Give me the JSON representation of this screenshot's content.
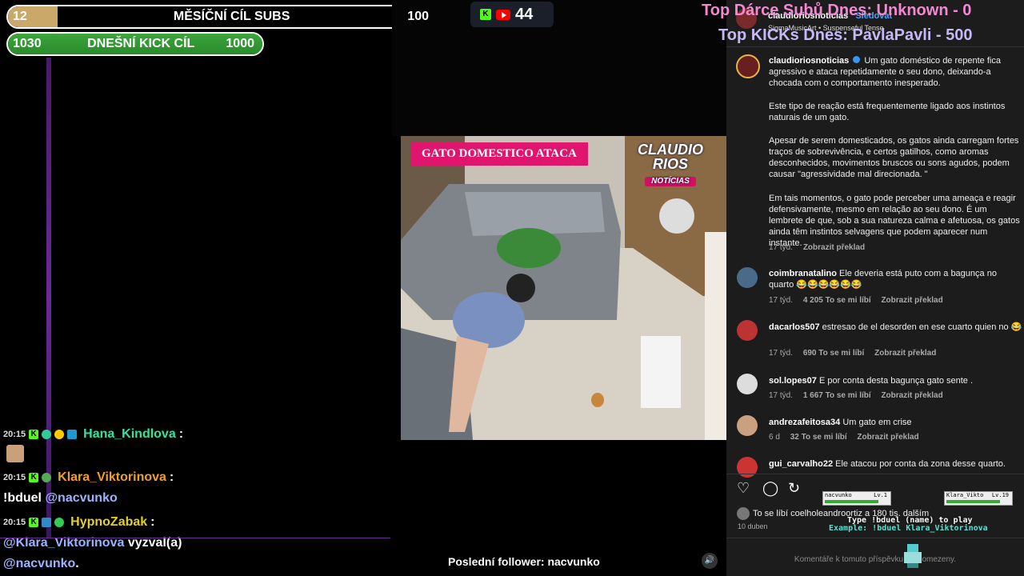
{
  "goals": {
    "monthly": {
      "current": "12",
      "label": "MĚSÍČNÍ CÍL SUBS",
      "target": "100",
      "progress": 0.12
    },
    "daily": {
      "current": "1030",
      "label": "DNEŠNÍ KICK CÍL",
      "target": "1000",
      "progress": 1.0
    }
  },
  "stream": {
    "viewers": "44",
    "video_title": "GATO DOMESTICO ATACA",
    "logo_line1": "CLAUDIO",
    "logo_line2": "RIOS",
    "logo_line3": "NOTÍCIAS",
    "last_follower": "Poslední follower: nacvunko"
  },
  "top": {
    "donor": "Top Dárce Subů Dnes: Unknown - 0",
    "kicks": "Top KICKs Dnes: PavlaPavli - 500"
  },
  "chat": [
    {
      "time": "20:15",
      "user": "Hana_Kindlova",
      "color": "#2ee6a0",
      "sep": ":"
    },
    {
      "time": "20:15",
      "user": "Klara_Viktorinova",
      "color": "#f0a020",
      "sep": ":",
      "msg_cmd": "!bduel",
      "msg_mention": "@nacvunko"
    },
    {
      "time": "20:15",
      "user": "HypnoZabak",
      "color": "#e6d020",
      "sep": ":",
      "msg_mention": "@Klara_Viktorinova",
      "msg_rest": "vyzval(a)",
      "msg_mention2": "@nacvunko",
      "msg_end": "."
    }
  ],
  "ig": {
    "header_user": "claudioriosnoticias",
    "header_follow": "Sledovat",
    "header_audio": "SigmaMusicArt • Suspenseful Tense",
    "caption_user": "claudioriosnoticias",
    "caption_p1": "Um gato doméstico de repente fica agressivo e ataca repetidamente o seu dono, deixando-a chocada com o comportamento inesperado.",
    "caption_p2": "Este tipo de reação está frequentemente ligado aos instintos naturais de um gato.",
    "caption_p3": "Apesar de serem domesticados, os gatos ainda carregam fortes traços de sobrevivência, e certos gatilhos, como aromas desconhecidos, movimentos bruscos ou sons agudos, podem causar \"agressividade mal direcionada. \"",
    "caption_p4": "Em tais momentos, o gato pode perceber uma ameaça e reagir defensivamente, mesmo em relação ao seu dono. É um lembrete de que, sob a sua natureza calma e afetuosa, os gatos ainda têm instintos selvagens que podem aparecer num instante.",
    "caption_time": "17 týd.",
    "translate": "Zobrazit překlad",
    "comments": [
      {
        "user": "coimbranatalino",
        "text": "Ele deveria está puto com a bagunça no quarto 😂😂😂😂😂😂",
        "time": "17 týd.",
        "likes": "4 205 To se mi líbí",
        "translate": "Zobrazit překlad"
      },
      {
        "user": "dacarlos507",
        "text": "estresao de el desorden en ese cuarto quien no 😂",
        "time": "17 týd.",
        "likes": "690 To se mi líbí",
        "translate": "Zobrazit překlad"
      },
      {
        "user": "sol.lopes07",
        "text": "E por conta desta bagunça gato sente .",
        "time": "17 týd.",
        "likes": "1 667 To se mi líbí",
        "translate": "Zobrazit překlad"
      },
      {
        "user": "andrezafeitosa34",
        "text": "Um gato em crise",
        "time": "6 d",
        "likes": "32 To se mi líbí",
        "translate": "Zobrazit překlad"
      },
      {
        "user": "gui_carvalho22",
        "text": "Ele atacou por conta da zona desse quarto."
      }
    ],
    "likes_line": "To se líbí coelholeandroortiz a 180 tis. dalším",
    "date": "10 duben",
    "comments_limited": "Komentáře k tomuto příspěvku byly omezeny."
  },
  "duel": {
    "player1": "nacvunko",
    "player1_lvl": "Lv.1",
    "player2": "Klara_Vikto",
    "player2_lvl": "Lv.19",
    "hint1": "Type !bduel (name) to play",
    "hint2": "Example: !bduel Klara_Viktorinova"
  },
  "colors": {
    "kick_green": "#53fc18",
    "mention": "#9ab4ff",
    "pink": "#e0156e"
  }
}
